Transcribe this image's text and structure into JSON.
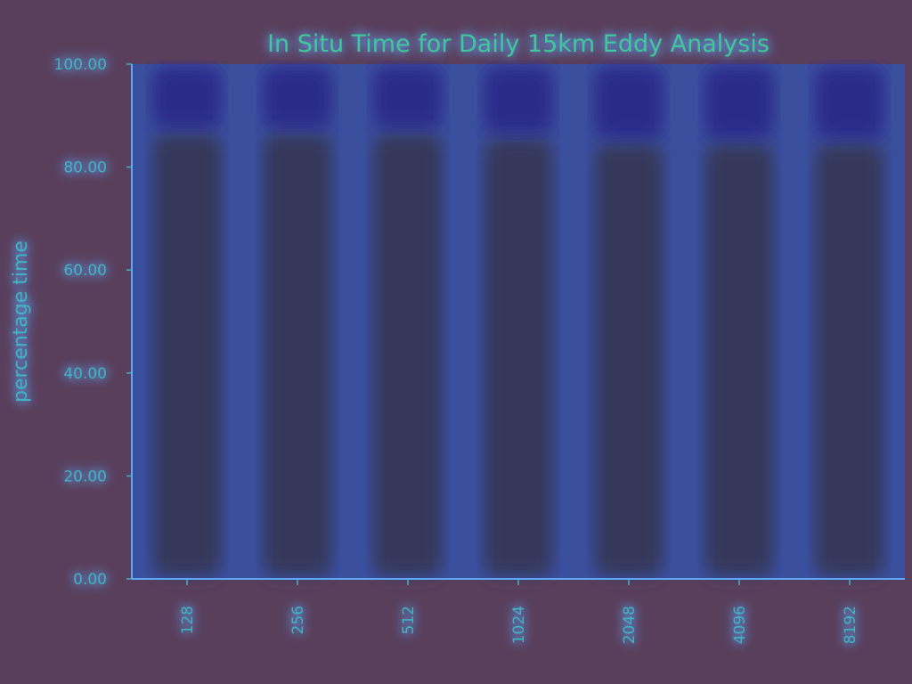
{
  "chart_data": {
    "type": "bar",
    "title": "In Situ Time for Daily 15km Eddy Analysis",
    "xlabel": "",
    "ylabel": "percentage time",
    "categories": [
      "128",
      "256",
      "512",
      "1024",
      "2048",
      "4096",
      "8192"
    ],
    "ylim": [
      0,
      100
    ],
    "yticks": [
      "0.00",
      "20.00",
      "40.00",
      "60.00",
      "80.00",
      "100.00"
    ],
    "series": [
      {
        "values": [
          87,
          87,
          87,
          86,
          85,
          85,
          85
        ]
      },
      {
        "values": [
          13,
          13,
          13,
          14,
          15,
          15,
          15
        ]
      }
    ],
    "grid": false,
    "legend": "none",
    "colors": {
      "background": "#5a3f5c",
      "plot_area": "#3a4e9e",
      "bar_lower": "#35385a",
      "bar_upper": "#2a2a88",
      "text": "#3fb4c0",
      "glow": "#5ea8ff",
      "title": "#3fc79a"
    }
  }
}
